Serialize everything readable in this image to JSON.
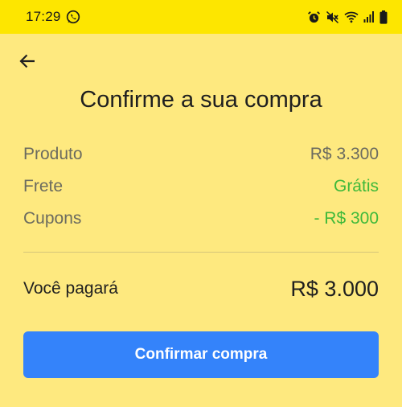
{
  "status_bar": {
    "time": "17:29",
    "left_icons": [
      "whatsapp-icon"
    ],
    "right_icons": [
      "alarm-icon",
      "mute-icon",
      "wifi-icon",
      "signal-icon",
      "battery-icon"
    ]
  },
  "header": {
    "back_icon": "arrow-left-icon"
  },
  "page": {
    "title": "Confirme a sua compra"
  },
  "summary": {
    "items": [
      {
        "label": "Produto",
        "value": "R$ 3.300"
      },
      {
        "label": "Frete",
        "value": "Grátis"
      },
      {
        "label": "Cupons",
        "value": "- R$ 300"
      }
    ]
  },
  "total": {
    "label": "Você pagará",
    "value": "R$ 3.000"
  },
  "actions": {
    "confirm_label": "Confirmar compra"
  },
  "colors": {
    "background": "#fee97f",
    "status_bar": "#fde600",
    "primary_button": "#3483fa",
    "positive_text": "#3fb93a",
    "muted_text": "#6b6b5f"
  }
}
